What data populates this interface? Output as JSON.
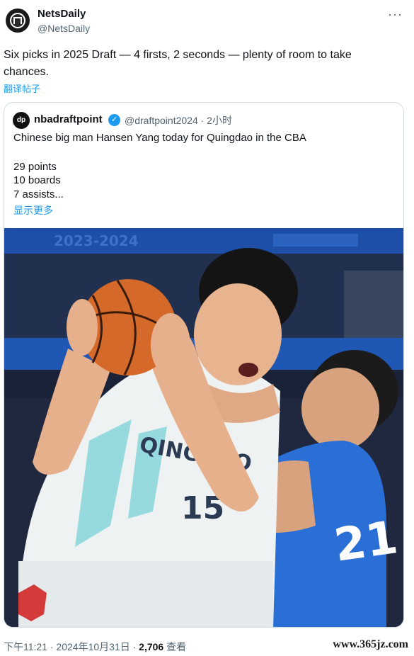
{
  "author": {
    "name": "NetsDaily",
    "handle": "@NetsDaily"
  },
  "tweet": {
    "text": "Six picks in 2025 Draft — 4 firsts, 2 seconds — plenty of room to take chances.",
    "translate_label": "翻译帖子"
  },
  "quoted": {
    "avatar_text": "dp",
    "name": "nbadraftpoint",
    "handle_time": "@draftpoint2024 · 2小时",
    "lines": [
      "Chinese big man Hansen Yang today for Quingdao in the CBA",
      "29 points",
      "10 boards",
      "7 assists..."
    ],
    "show_more": "显示更多",
    "photo": {
      "banner_text": "2023-2024",
      "jersey_text": "QINGDAO",
      "jersey_number": "15",
      "opponent_number": "21"
    }
  },
  "footer": {
    "time_date": "下午11:21 · 2024年10月31日 · ",
    "views_count": "2,706",
    "views_label": " 查看"
  },
  "watermark": "www.365jz.com",
  "colors": {
    "link": "#1d9bf0",
    "muted": "#536471",
    "text": "#0f1419",
    "border": "#cfd9de"
  },
  "icons": {
    "more": "more-horizontal-icon",
    "verified": "verified-badge-icon"
  }
}
